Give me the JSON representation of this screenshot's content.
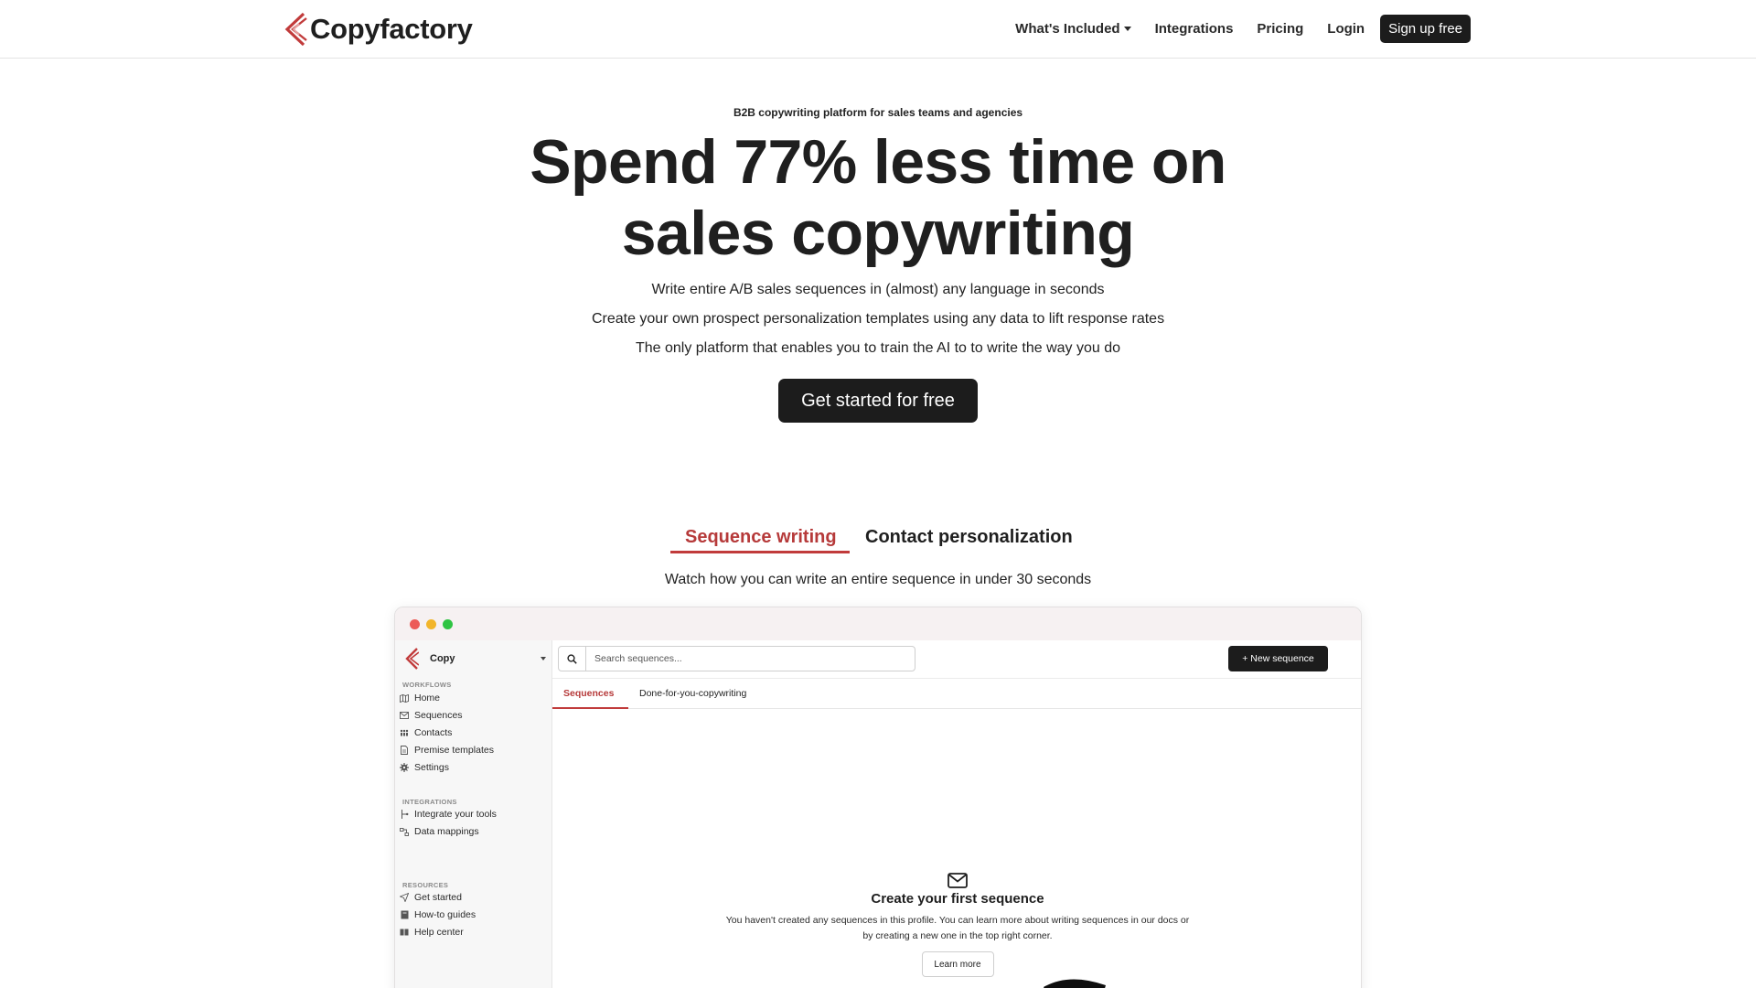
{
  "nav": {
    "brand": "Copyfactory",
    "links": [
      "What's Included",
      "Integrations",
      "Pricing",
      "Login"
    ],
    "signup": "Sign up free"
  },
  "hero": {
    "eyebrow": "B2B copywriting platform for sales teams and agencies",
    "headline_line1": "Spend 77% less time on",
    "headline_line2": "sales copywriting",
    "bullets": [
      "Write entire A/B sales sequences in (almost) any language in seconds",
      "Create your own prospect personalization templates using any data to lift response rates",
      "The only platform that enables you to train the AI to to write the way you do"
    ],
    "cta": "Get started for free"
  },
  "features": {
    "tabs": [
      "Sequence writing",
      "Contact personalization"
    ],
    "active_tab": "Sequence writing",
    "caption": "Watch how you can write an entire sequence in under 30 seconds"
  },
  "app": {
    "workspace": "Copy",
    "sections": {
      "workflows": "WORKFLOWS",
      "integrations": "INTEGRATIONS",
      "resources": "RESOURCES"
    },
    "workflow_items": [
      "Home",
      "Sequences",
      "Contacts",
      "Premise templates",
      "Settings"
    ],
    "integration_items": [
      "Integrate your tools",
      "Data mappings"
    ],
    "resource_items": [
      "Get started",
      "How-to guides",
      "Help center"
    ],
    "search_placeholder": "Search sequences...",
    "new_button": "+ New sequence",
    "subtabs": [
      "Sequences",
      "Done-for-you-copywriting"
    ],
    "empty_title": "Create your first sequence",
    "empty_desc": "You haven't created any sequences in this profile. You can learn more about writing sequences in our docs or by creating a new one in the top right corner.",
    "learn_more": "Learn more"
  },
  "colors": {
    "brand_red": "#c13b3b",
    "dark": "#1c1c1c",
    "traffic_red": "#ec5b57",
    "traffic_yellow": "#f2b52b",
    "traffic_green": "#2fc443"
  }
}
